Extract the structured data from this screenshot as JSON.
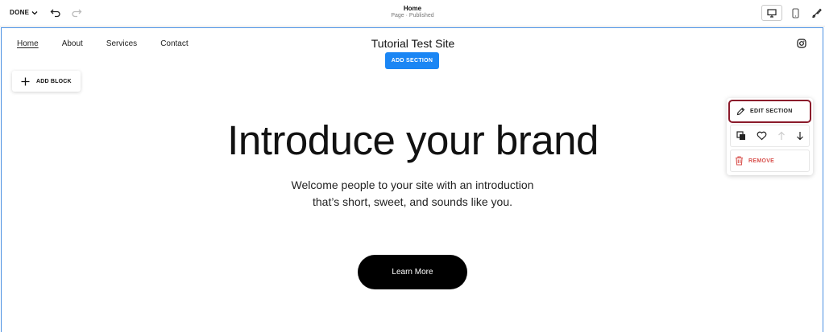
{
  "topbar": {
    "done_label": "DONE",
    "page_title": "Home",
    "page_status": "Page · Published",
    "icons": [
      "chevron-down-icon",
      "undo-icon",
      "redo-icon",
      "desktop-icon",
      "mobile-icon",
      "paintbrush-icon"
    ]
  },
  "site": {
    "title": "Tutorial Test Site",
    "nav": [
      "Home",
      "About",
      "Services",
      "Contact"
    ],
    "active_nav": "Home",
    "add_section_label": "ADD SECTION",
    "add_block_label": "ADD BLOCK"
  },
  "hero": {
    "title": "Introduce your brand",
    "subtitle_line1": "Welcome people to your site with an introduction",
    "subtitle_line2": "that’s short, sweet, and sounds like you.",
    "button_label": "Learn More"
  },
  "section_panel": {
    "edit_label": "EDIT SECTION",
    "remove_label": "REMOVE",
    "icons": [
      "duplicate-icon",
      "heart-icon",
      "arrow-up-icon",
      "arrow-down-icon",
      "trash-icon"
    ]
  },
  "colors": {
    "accent_blue": "#1b86f4",
    "canvas_border": "#4a90e2",
    "edit_highlight": "#8b1a2b",
    "remove_red": "#d9534f"
  }
}
